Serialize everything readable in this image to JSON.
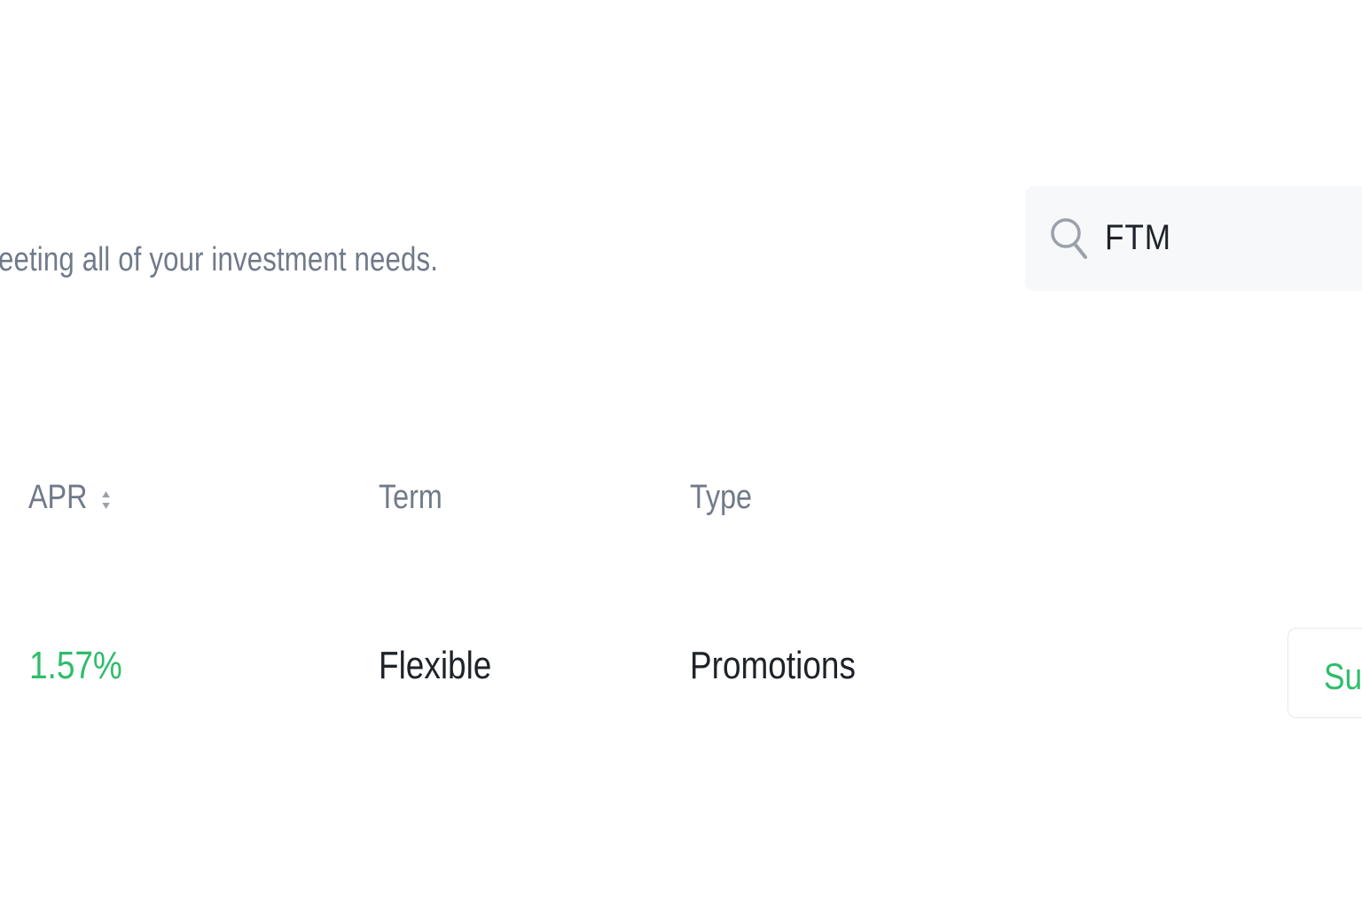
{
  "header": {
    "subtitle": "eeting all of your investment needs."
  },
  "search": {
    "value": "FTM",
    "icon": "search-icon"
  },
  "table": {
    "columns": [
      {
        "label": "APR",
        "sortable": true
      },
      {
        "label": "Term"
      },
      {
        "label": "Type"
      }
    ],
    "rows": [
      {
        "apr": "1.57%",
        "term": "Flexible",
        "type": "Promotions",
        "action_label": "Su"
      }
    ]
  },
  "colors": {
    "positive": "#2ebd6b",
    "text_primary": "#1e2329",
    "text_secondary": "#707a8a",
    "search_bg": "#f7f8f9"
  }
}
